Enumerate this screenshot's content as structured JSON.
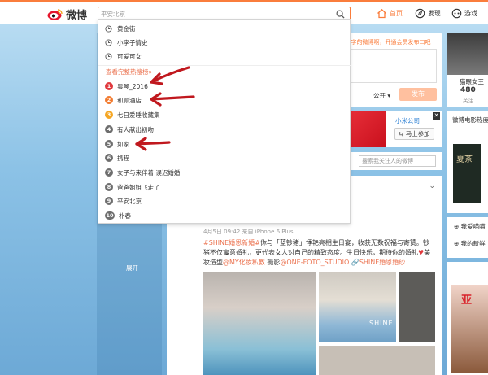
{
  "header": {
    "logo_text": "微博",
    "search_placeholder": "平安北京",
    "nav": {
      "home": "首页",
      "discover": "发现",
      "game": "游戏"
    }
  },
  "dropdown": {
    "history": [
      "黄金街",
      "小李子情史",
      "可爱可女"
    ],
    "more_hot": "查看完整热搜榜»",
    "hot": [
      {
        "rank": "1",
        "text": "粤琴_2016"
      },
      {
        "rank": "2",
        "text": "和顾酒店"
      },
      {
        "rank": "3",
        "text": "七日爱睡收藏集"
      },
      {
        "rank": "4",
        "text": "有人献出初吻"
      },
      {
        "rank": "5",
        "text": "如家"
      },
      {
        "rank": "6",
        "text": "携程"
      },
      {
        "rank": "7",
        "text": "女子与来伴着 误迟婚婚"
      },
      {
        "rank": "8",
        "text": "爸爸姐姐飞走了"
      },
      {
        "rank": "9",
        "text": "平安北京"
      },
      {
        "rank": "10",
        "text": "朴春"
      }
    ]
  },
  "compose": {
    "hint": "0字的微博啊，开通会员发布口吧",
    "visibility": "公开",
    "post_button": "发布"
  },
  "ad": {
    "brand": "小米公司",
    "join": "马上参加"
  },
  "filter": {
    "search_placeholder": "搜索我关注人的微博"
  },
  "leftnav": {
    "expand": "展开"
  },
  "feed": {
    "meta": "4月5日 09:42 来自 iPhone 6 Plus",
    "text_parts": {
      "tag1": "#SHINE婚恩新婚#",
      "body1": "你与「蓝钞猪」悸艳亮相生日宴，收获无数祝福与寄赞。钞猪不仅寓意婚礼，更代表女人对自己的精致态度。生日快乐，期待你的婚礼",
      "body2": "美妆造型",
      "mention1": "@MY化妆私教",
      "body3": " 摄影",
      "mention2": "@ONE-FOTO_STUDIO",
      "link": "SHINE婚恩婚纱"
    },
    "watermark": "SHINE"
  },
  "right": {
    "profile_name": "猫眼女王",
    "count": "480",
    "count_label": "关注",
    "movie_box_title": "微博电影热度",
    "poster_text": "夏茶",
    "list": [
      "我爱喵喵",
      "我的新鲜"
    ],
    "poster2": "亚"
  },
  "colors": {
    "accent": "#fa7d3c",
    "hot_rank": "#e0393e",
    "link": "#eb7350",
    "arrow": "#c0181e"
  }
}
